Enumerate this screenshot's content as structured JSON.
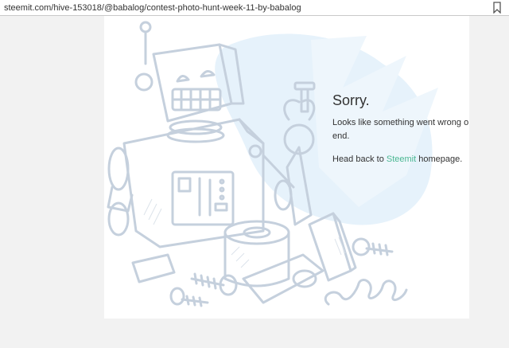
{
  "browser": {
    "url": "steemit.com/hive-153018/@babalog/contest-photo-hunt-week-11-by-babalog",
    "bookmark_icon": "bookmark-icon"
  },
  "error_page": {
    "title": "Sorry.",
    "message": "Looks like something went wrong on our end.",
    "back_prefix": "Head back to ",
    "back_link": "Steemit",
    "back_suffix": " homepage."
  },
  "illustration": {
    "icon": "broken-robot-illustration",
    "stroke_color": "#c5d0dd",
    "accent_color": "#e3f0fa"
  },
  "colors": {
    "link": "#4ab792",
    "text": "#333333"
  }
}
